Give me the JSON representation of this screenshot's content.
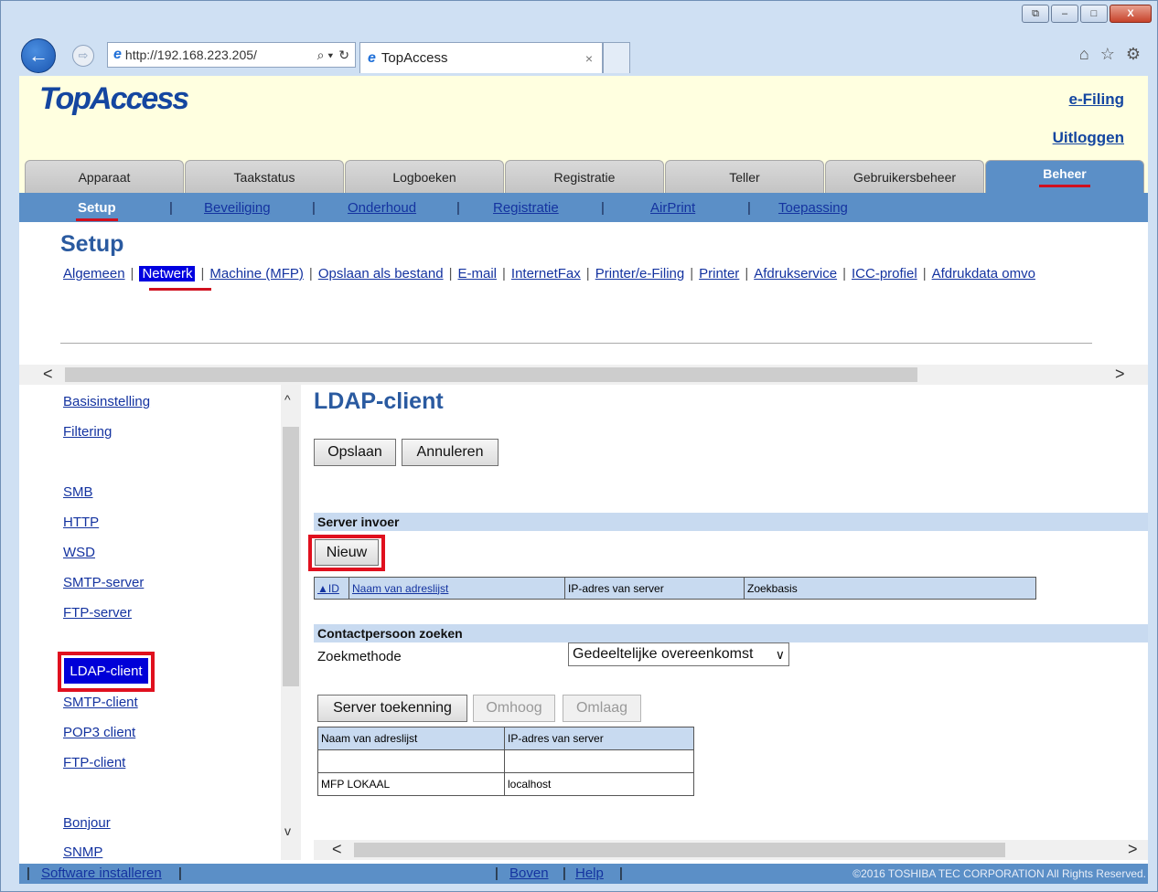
{
  "browser": {
    "url": "http://192.168.223.205/",
    "tab_title": "TopAccess",
    "tab_close": "×",
    "back_glyph": "←",
    "forward_glyph": "⇨",
    "search_glyph": "⌕ ▾",
    "refresh_glyph": "↻",
    "home_glyph": "⌂",
    "fav_glyph": "☆",
    "settings_glyph": "⚙",
    "win_min": "–",
    "win_max": "□",
    "win_close": "X"
  },
  "header": {
    "logo": "TopAccess",
    "efiling": "e-Filing",
    "logout": "Uitloggen"
  },
  "main_tabs": [
    {
      "label": "Apparaat"
    },
    {
      "label": "Taakstatus"
    },
    {
      "label": "Logboeken"
    },
    {
      "label": "Registratie"
    },
    {
      "label": "Teller"
    },
    {
      "label": "Gebruikersbeheer"
    },
    {
      "label": "Beheer"
    }
  ],
  "sub_nav": [
    {
      "label": "Setup"
    },
    {
      "label": "Beveiliging"
    },
    {
      "label": "Onderhoud"
    },
    {
      "label": "Registratie"
    },
    {
      "label": "AirPrint"
    },
    {
      "label": "Toepassing"
    }
  ],
  "page_title": "Setup",
  "top_links": [
    {
      "label": "Algemeen"
    },
    {
      "label": "Netwerk"
    },
    {
      "label": "Machine (MFP)"
    },
    {
      "label": "Opslaan als bestand"
    },
    {
      "label": "E-mail"
    },
    {
      "label": "InternetFax"
    },
    {
      "label": "Printer/e-Filing"
    },
    {
      "label": "Printer"
    },
    {
      "label": "Afdrukservice"
    },
    {
      "label": "ICC-profiel"
    },
    {
      "label": "Afdrukdata omvo"
    }
  ],
  "left_menu": [
    {
      "label": "Basisinstelling"
    },
    {
      "label": "Filtering"
    },
    {
      "label": "SMB"
    },
    {
      "label": "HTTP"
    },
    {
      "label": "WSD"
    },
    {
      "label": "SMTP-server"
    },
    {
      "label": "FTP-server"
    },
    {
      "label": "LDAP-client"
    },
    {
      "label": "SMTP-client"
    },
    {
      "label": "POP3 client"
    },
    {
      "label": "FTP-client"
    },
    {
      "label": "Bonjour"
    },
    {
      "label": "SNMP"
    }
  ],
  "ldap": {
    "title": "LDAP-client",
    "save": "Opslaan",
    "cancel": "Annuleren",
    "server_section": "Server invoer",
    "new_button": "Nieuw",
    "server_table_headers": [
      "ID",
      "Naam van adreslijst",
      "IP-adres van server",
      "Zoekbasis"
    ],
    "contact_section": "Contactpersoon zoeken",
    "search_method_label": "Zoekmethode",
    "search_method_value": "Gedeeltelijke overeenkomst",
    "assign_button": "Server toekenning",
    "up_button": "Omhoog",
    "down_button": "Omlaag",
    "addr_table_headers": [
      "Naam van adreslijst",
      "IP-adres van server"
    ],
    "addr_rows": [
      [
        "",
        ""
      ],
      [
        "MFP LOKAAL",
        "localhost"
      ]
    ]
  },
  "footer": {
    "install": "Software installeren",
    "top": "Boven",
    "help": "Help",
    "copyright": "©2016 TOSHIBA TEC CORPORATION All Rights Reserved."
  },
  "colors": {
    "accent_blue": "#5b8fc7",
    "highlight_red": "#e0101e",
    "selected_blue": "#0000d8",
    "header_yellow": "#ffffe0"
  }
}
